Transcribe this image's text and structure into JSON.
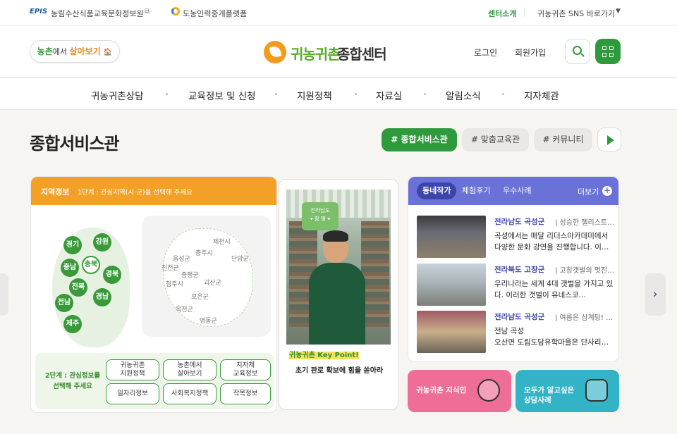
{
  "topbar": {
    "epis_logo": "EPIS",
    "site1": "농림수산식품교육문화정보원",
    "site2": "도농인력중개플랫폼",
    "center_intro": "센터소개",
    "sns": "귀농귀촌 SNS 바로가기",
    "caret": "▼"
  },
  "header": {
    "pill": {
      "g": "농촌",
      "k": "에서 ",
      "o": "살아보기",
      "icon": "🏠"
    },
    "logo_part1": "귀농귀촌",
    "logo_part2": "종합센터",
    "login": "로그인",
    "signup": "회원가입"
  },
  "gnb": [
    "귀농귀촌상담",
    "교육정보 및 신청",
    "지원정책",
    "자료실",
    "알림소식",
    "지자체관"
  ],
  "section": {
    "title": "종합서비스관",
    "tags": [
      "# 종합서비스관",
      "# 맞춤교육관",
      "# 커뮤니티"
    ]
  },
  "region": {
    "head_title": "지역정보",
    "head_step": "1단계 : 관심지역(시·군)을 선택해 주세요",
    "provinces": [
      "경기",
      "강원",
      "충남",
      "충북",
      "경북",
      "전북",
      "경남",
      "전남",
      "제주"
    ],
    "counties": [
      "제천시",
      "충주시",
      "음성군",
      "단양군",
      "진천군",
      "증평군",
      "청주시",
      "괴산군",
      "보은군",
      "옥천군",
      "영동군"
    ],
    "step2_label": "2단계 : 관심정보를 선택해 주세요",
    "chips": [
      "귀농귀촌\n지원정책",
      "농촌에서\n살아보기",
      "지자체\n교육정보",
      "일자리정보",
      "사회복지정책",
      "작목정보"
    ]
  },
  "promo": {
    "badge_line1": "전라남도",
    "badge_line2": "▾ 함 평 ▾",
    "keypoint_label": "귀농귀촌 Key Point!",
    "keypoint_text": "초기 판로 확보에 힘을 쏟아라"
  },
  "news": {
    "tabs": [
      "동네작가",
      "체험후기",
      "우수사례"
    ],
    "more": "더보기",
    "articles": [
      {
        "region": "전라남도 곡성군",
        "title": "| 성승한 젤리스트…",
        "desc": "곡성에서는 매달 리더스아카데미에서 다양한 문화 강연을 진행합니다. 이…"
      },
      {
        "region": "전라북도 고창군",
        "title": "| 고창갯벌의 멋진…",
        "desc": "우리나라는 세계 4대 갯벌을 가지고 있다. 이러한 갯벌이 유네스코…"
      },
      {
        "region": "전라남도 곡성군",
        "title": "| 여름은 삼계탕! …",
        "desc": "전남 곡성\n오산면 도림도담유학마을은 단사리…"
      }
    ]
  },
  "quick": [
    {
      "label": "귀농귀촌 지식인",
      "color": "#ef6e97"
    },
    {
      "label": "모두가 알고싶은\n상담사례",
      "color": "#33b3c6"
    }
  ],
  "colors": {
    "green": "#2e9a3b",
    "orange": "#f3a126",
    "purple": "#6a72d8"
  }
}
